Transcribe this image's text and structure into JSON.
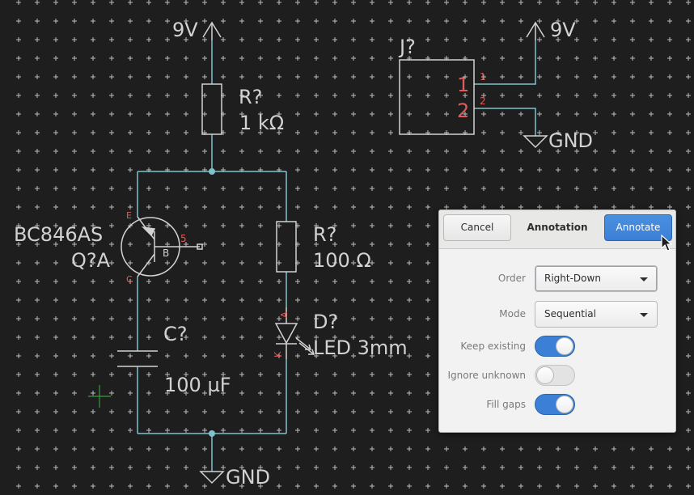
{
  "schematic": {
    "power_top_left": "9V",
    "power_top_right": "9V",
    "gnd_bottom": "GND",
    "gnd_connector": "GND",
    "connector": {
      "ref": "J?",
      "pin1_num": "1",
      "pin2_num": "2",
      "pin1_name": "1",
      "pin2_name": "2"
    },
    "r1": {
      "ref": "R?",
      "value": "1 kΩ"
    },
    "r2": {
      "ref": "R?",
      "value": "100 Ω"
    },
    "transistor": {
      "part": "BC846AS",
      "ref": "Q?A",
      "pin_e": "E",
      "pin_c": "C",
      "pin_b": "B",
      "pin_5": "5"
    },
    "capacitor": {
      "ref": "C?",
      "value": "100 µF"
    },
    "led": {
      "ref": "D?",
      "value": "LED 3mm",
      "pin_a": "A",
      "pin_k": "K"
    },
    "colors": {
      "wire": "#7fc2cc",
      "symbol": "#d2d2d2",
      "pin_number": "#e05a5a",
      "grid": "#bdbdbd",
      "cursor_cross": "#3a9a3a",
      "background": "#1e1e1e"
    }
  },
  "dialog": {
    "title": "Annotation",
    "cancel_label": "Cancel",
    "annotate_label": "Annotate",
    "order_label": "Order",
    "order_value": "Right-Down",
    "mode_label": "Mode",
    "mode_value": "Sequential",
    "keep_existing_label": "Keep existing",
    "keep_existing_on": true,
    "ignore_unknown_label": "Ignore unknown",
    "ignore_unknown_on": false,
    "fill_gaps_label": "Fill gaps",
    "fill_gaps_on": true
  }
}
